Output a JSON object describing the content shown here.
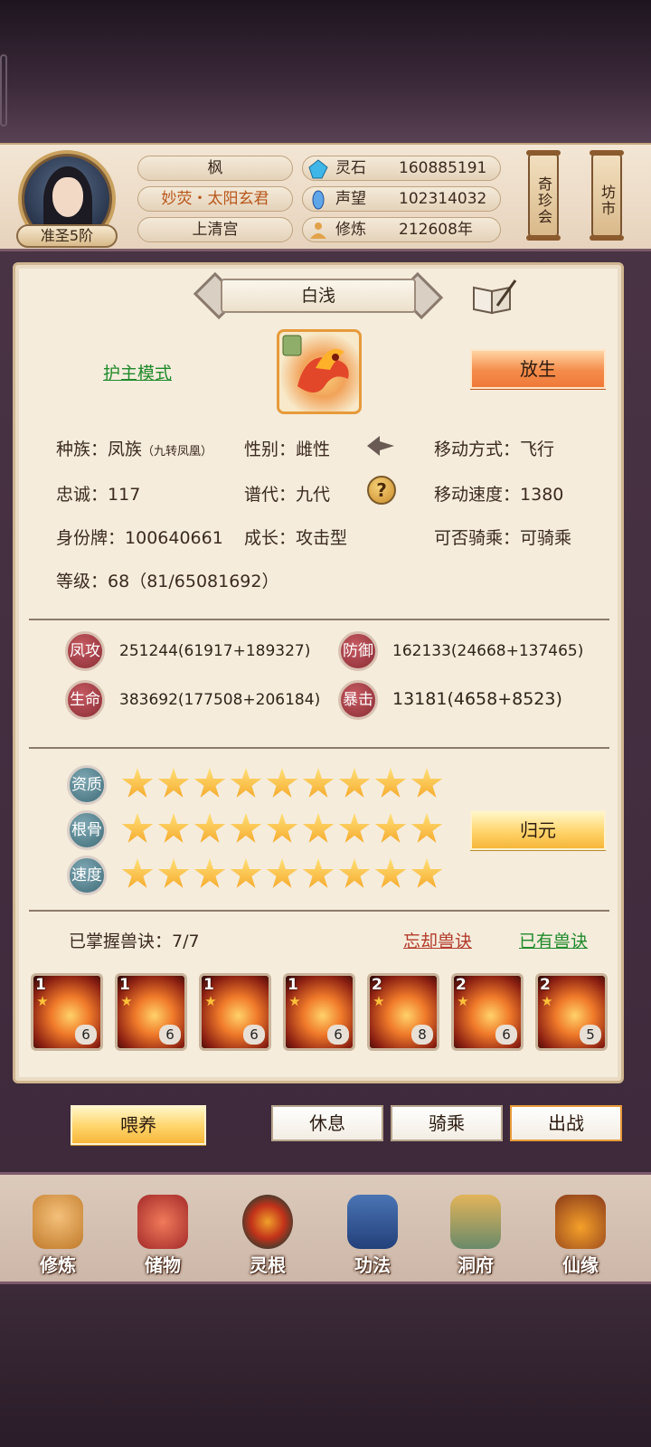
{
  "player": {
    "name": "枫",
    "title": "妙荧・太阳玄君",
    "sect": "上清宫",
    "rank": "准圣5阶"
  },
  "resources": [
    {
      "icon": "spirit-stone-icon",
      "label": "灵石",
      "value": "160885191"
    },
    {
      "icon": "prestige-icon",
      "label": "声望",
      "value": "102314032"
    },
    {
      "icon": "meditation-icon",
      "label": "修炼",
      "value": "212608年"
    }
  ],
  "shortcuts": {
    "treasure_label": "奇珍会",
    "market_label": "坊市"
  },
  "pet": {
    "name": "白浅",
    "mode_link": "护主模式",
    "release_label": "放生",
    "race_label": "种族：",
    "race_value": "凤族",
    "race_sub": "（九转凤凰）",
    "gender_label": "性别：",
    "gender_value": "雌性",
    "move_type_label": "移动方式：",
    "move_type_value": "飞行",
    "loyalty_label": "忠诚：",
    "loyalty_value": "117",
    "generation_label": "谱代：",
    "generation_value": "九代",
    "move_speed_label": "移动速度：",
    "move_speed_value": "1380",
    "id_label": "身份牌：",
    "id_value": "100640661",
    "growth_label": "成长：",
    "growth_value": "攻击型",
    "rideable_label": "可否骑乘：",
    "rideable_value": "可骑乘",
    "level_label": "等级：",
    "level_value": "68（81/65081692）"
  },
  "stats": [
    {
      "badge": "凤攻",
      "value": "251244(61917+189327)"
    },
    {
      "badge": "防御",
      "value": "162133(24668+137465)"
    },
    {
      "badge": "生命",
      "value": "383692(177508+206184)"
    },
    {
      "badge": "暴击",
      "value": "13181(4658+8523)"
    }
  ],
  "aptitudes": [
    {
      "badge": "资质",
      "stars": 9
    },
    {
      "badge": "根骨",
      "stars": 9
    },
    {
      "badge": "速度",
      "stars": 9
    }
  ],
  "return_origin_label": "归元",
  "skills": {
    "mastered_label": "已掌握兽诀：7/7",
    "forget_link": "忘却兽诀",
    "owned_link": "已有兽诀",
    "items": [
      {
        "level": "1",
        "count": "6"
      },
      {
        "level": "1",
        "count": "6"
      },
      {
        "level": "1",
        "count": "6"
      },
      {
        "level": "1",
        "count": "6"
      },
      {
        "level": "2",
        "count": "8"
      },
      {
        "level": "2",
        "count": "6"
      },
      {
        "level": "2",
        "count": "5"
      }
    ]
  },
  "actions": {
    "feed": "喂养",
    "rest": "休息",
    "ride": "骑乘",
    "battle": "出战"
  },
  "nav": [
    {
      "icon": "cultivate-icon",
      "label": "修炼"
    },
    {
      "icon": "storage-bag-icon",
      "label": "储物"
    },
    {
      "icon": "spirit-root-icon",
      "label": "灵根"
    },
    {
      "icon": "technique-book-icon",
      "label": "功法"
    },
    {
      "icon": "cave-mansion-icon",
      "label": "洞府"
    },
    {
      "icon": "immortal-fate-icon",
      "label": "仙缘"
    }
  ],
  "colors": {
    "accent_orange": "#f48b4a",
    "accent_gold": "#f6b63a",
    "link_green": "#1f8a2a",
    "link_red": "#b23a2a"
  }
}
